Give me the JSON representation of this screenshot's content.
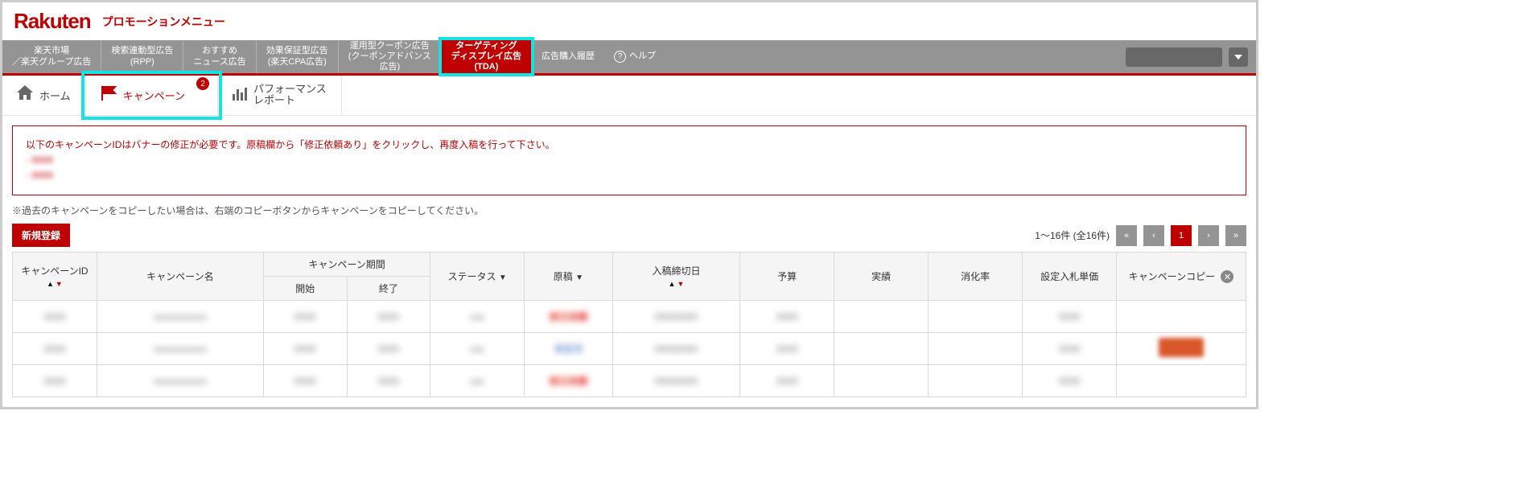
{
  "brand": "Rakuten",
  "header_title": "プロモーションメニュー",
  "nav": [
    {
      "l1": "楽天市場",
      "l2": "／楽天グループ広告"
    },
    {
      "l1": "検索連動型広告",
      "l2": "(RPP)"
    },
    {
      "l1": "おすすめ",
      "l2": "ニュース広告"
    },
    {
      "l1": "効果保証型広告",
      "l2": "(楽天CPA広告)"
    },
    {
      "l1": "運用型クーポン広告",
      "l2": "(クーポンアドバンス",
      "l3": "広告)"
    },
    {
      "l1": "ターゲティング",
      "l2": "ディスプレイ広告",
      "l3": "(TDA)"
    },
    {
      "l1": "広告購入履歴",
      "l2": ""
    },
    {
      "l1": "ヘルプ",
      "l2": ""
    }
  ],
  "subtabs": {
    "home": "ホーム",
    "campaign": "キャンペーン",
    "badge": "2",
    "report_l1": "パフォーマンス",
    "report_l2": "レポート"
  },
  "alert": {
    "msg": "以下のキャンペーンIDはバナーの修正が必要です。原稿欄から「修正依頼あり」をクリックし、再度入稿を行って下さい。",
    "items": [
      "- 0000",
      "- 0000"
    ]
  },
  "note_copy": "※過去のキャンペーンをコピーしたい場合は、右端のコピーボタンからキャンペーンをコピーしてください。",
  "btn_new": "新規登録",
  "page_summary": "1～16件 (全16件)",
  "pager": {
    "first": "«",
    "prev": "‹",
    "current": "1",
    "next": "›",
    "last": "»"
  },
  "cols": {
    "id": "キャンペーンID",
    "name": "キャンペーン名",
    "period": "キャンペーン期間",
    "start": "開始",
    "end": "終了",
    "status": "ステータス",
    "creative": "原稿",
    "deadline": "入稿締切日",
    "budget": "予算",
    "actual": "実績",
    "rate": "消化率",
    "bid": "設定入札単価",
    "copy": "キャンペーンコピー"
  }
}
